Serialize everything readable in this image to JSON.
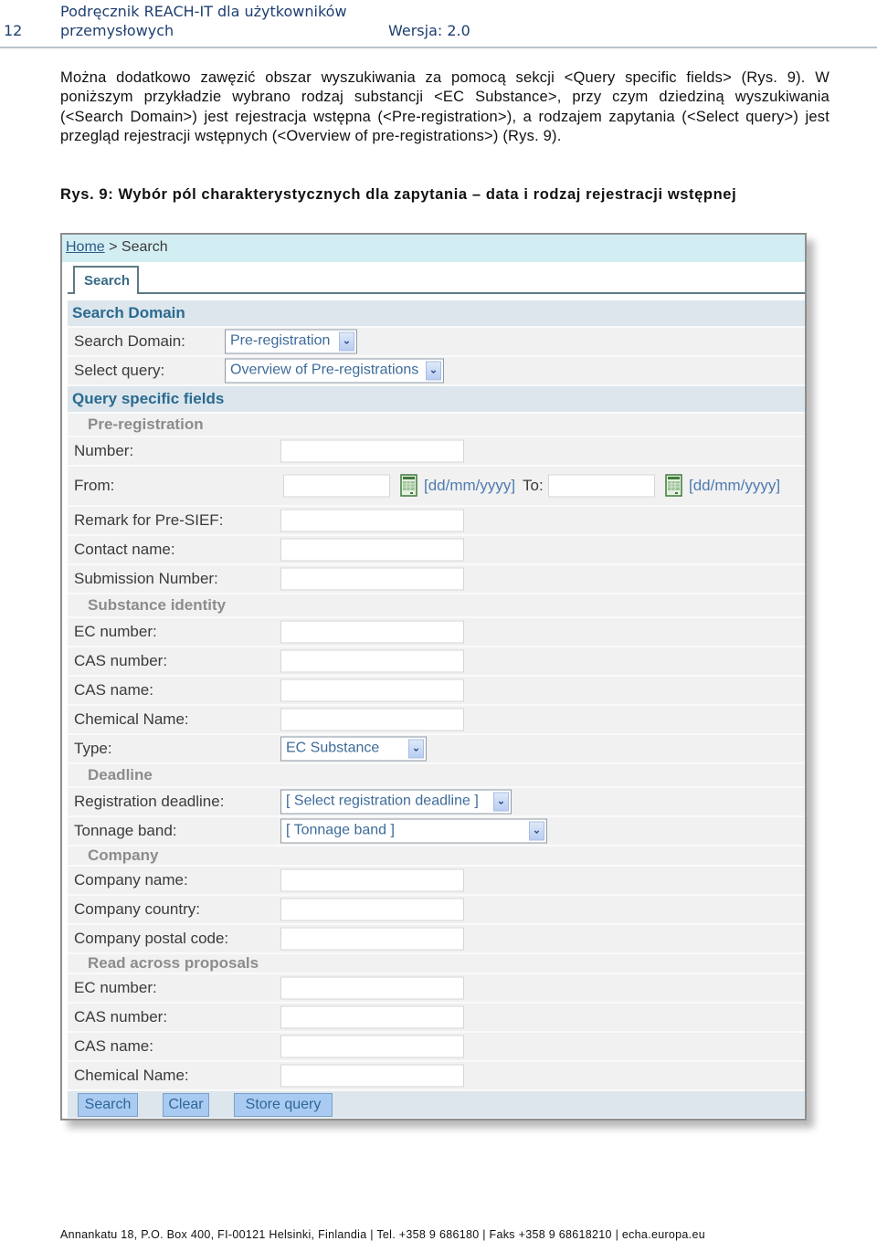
{
  "document": {
    "page_number": "12",
    "title_line1": "Podręcznik REACH-IT dla użytkowników",
    "title_line2": "przemysłowych",
    "version": "Wersja: 2.0",
    "paragraph": "Można dodatkowo zawęzić obszar wyszukiwania za pomocą sekcji <Query specific fields> (Rys. 9). W poniższym przykładzie wybrano rodzaj substancji <EC Substance>, przy czym dziedziną wyszukiwania (<Search Domain>) jest rejestracja wstępna (<Pre-registration>), a rodzajem zapytania (<Select query>) jest przegląd rejestracji wstępnych (<Overview of pre-registrations>) (Rys. 9).",
    "figure_caption": "Rys. 9: Wybór pól charakterystycznych dla zapytania – data i rodzaj rejestracji wstępnej",
    "footer": "Annankatu 18, P.O. Box 400, FI-00121 Helsinki, Finlandia | Tel. +358 9 686180 | Faks +358 9 68618210 | echa.europa.eu"
  },
  "screenshot": {
    "breadcrumb": {
      "home": "Home",
      "separator": " > ",
      "current": "Search"
    },
    "tab_label": "Search",
    "search_domain_section": "Search Domain",
    "search_domain_label": "Search Domain:",
    "search_domain_value": "Pre-registration",
    "select_query_label": "Select query:",
    "select_query_value": "Overview of Pre-registrations",
    "query_fields_section": "Query specific fields",
    "pre_registration": {
      "heading": "Pre-registration",
      "number_label": "Number:",
      "number_value": "",
      "from_label": "From:",
      "from_value": "",
      "date_format_hint": "[dd/mm/yyyy]",
      "to_label": "To:",
      "to_value": "",
      "remark_label": "Remark for Pre-SIEF:",
      "contact_label": "Contact name:",
      "submission_label": "Submission Number:"
    },
    "substance_identity": {
      "heading": "Substance identity",
      "ec_number_label": "EC number:",
      "cas_number_label": "CAS number:",
      "cas_name_label": "CAS name:",
      "chemical_name_label": "Chemical Name:",
      "type_label": "Type:",
      "type_value": "EC Substance"
    },
    "deadline": {
      "heading": "Deadline",
      "registration_deadline_label": "Registration deadline:",
      "registration_deadline_value": "[ Select registration deadline ]",
      "tonnage_label": "Tonnage band:",
      "tonnage_value": "[ Tonnage band ]"
    },
    "company": {
      "heading": "Company",
      "name_label": "Company name:",
      "country_label": "Company country:",
      "postal_label": "Company postal code:"
    },
    "read_across": {
      "heading": "Read across proposals",
      "ec_number_label": "EC number:",
      "cas_number_label": "CAS number:",
      "cas_name_label": "CAS name:",
      "chemical_name_label": "Chemical Name:"
    },
    "buttons": {
      "search": "Search",
      "clear": "Clear",
      "store_query": "Store query"
    },
    "icons": {
      "calendar": "calendar-icon",
      "dropdown": "chevron-down-icon"
    }
  }
}
